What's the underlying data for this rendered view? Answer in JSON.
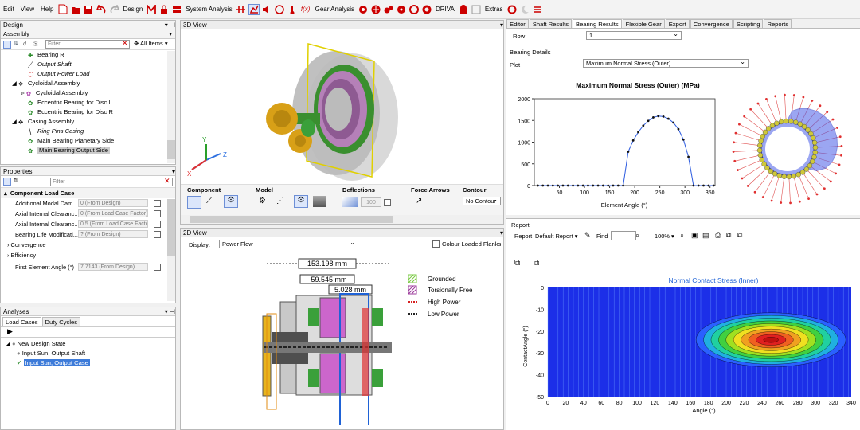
{
  "menu": {
    "edit": "Edit",
    "view": "View",
    "help": "Help",
    "design": "Design",
    "system_analysis": "System Analysis",
    "gear_analysis": "Gear Analysis",
    "driva": "DRIVA",
    "extras": "Extras"
  },
  "design_panel": {
    "title": "Design",
    "dropdown": "Assembly",
    "filter_placeholder": "Filter",
    "all_items": "All Items",
    "tree": [
      {
        "label": "Bearing R",
        "italic": false
      },
      {
        "label": "Output Shaft",
        "italic": true
      },
      {
        "label": "Output Power Load",
        "italic": true
      },
      {
        "label": "Cycloidal Assembly",
        "italic": false
      },
      {
        "label": "Cycloidal Assembly",
        "italic": false
      },
      {
        "label": "Eccentric Bearing for Disc L",
        "italic": false
      },
      {
        "label": "Eccentric Bearing for Disc R",
        "italic": false
      },
      {
        "label": "Casing Assembly",
        "italic": false
      },
      {
        "label": "Ring Pins Casing",
        "italic": true
      },
      {
        "label": "Main Bearing Planetary Side",
        "italic": false
      },
      {
        "label": "Main Bearing Output Side",
        "italic": false
      }
    ]
  },
  "properties": {
    "title": "Properties",
    "filter_placeholder": "Filter",
    "section": "Component Load Case",
    "rows": [
      {
        "label": "Additional Modal Dam...",
        "value": "0 (From Design)"
      },
      {
        "label": "Axial Internal Clearanc...",
        "value": "0 (From Load Case Factor)"
      },
      {
        "label": "Axial Internal Clearanc...",
        "value": "0.5 (From Load Case Factor)"
      },
      {
        "label": "Bearing Life Modificati...",
        "value": "? (From Design)"
      }
    ],
    "groups": [
      "Convergence",
      "Efficiency"
    ],
    "last_row": {
      "label": "First Element Angle (°)",
      "value": "7.7143 (From Design)"
    }
  },
  "analyses": {
    "title": "Analyses",
    "tabs": [
      "Load Cases",
      "Duty Cycles"
    ],
    "root": "New Design State",
    "items": [
      "Input Sun, Output Shaft",
      "Input Sun, Output Case"
    ]
  },
  "view3d": {
    "title": "3D View",
    "groups": {
      "component": "Component",
      "model": "Model",
      "deflections": "Deflections",
      "force_arrows": "Force Arrows",
      "contour": "Contour"
    },
    "deflection_value": "100",
    "contour_value": "No Contour",
    "axes": {
      "x": "X",
      "y": "Y",
      "z": "Z"
    }
  },
  "view2d": {
    "title": "2D View",
    "display_label": "Display:",
    "display_value": "Power Flow",
    "colour_flanks": "Colour Loaded Flanks",
    "dims": [
      "153.198 mm",
      "59.545 mm",
      "5.028 mm"
    ],
    "legend": [
      {
        "label": "Grounded",
        "color": "#7ac943"
      },
      {
        "label": "Torsionally Free",
        "color": "#9b3a9b"
      },
      {
        "label": "High Power",
        "color": "#d62020"
      },
      {
        "label": "Low Power",
        "color": "#222222"
      }
    ]
  },
  "right_tabs": [
    "Editor",
    "Shaft Results",
    "Bearing Results",
    "Flexible Gear",
    "Export",
    "Convergence",
    "Scripting",
    "Reports"
  ],
  "bearing": {
    "row_label": "Row",
    "row_value": "1",
    "details": "Bearing Details",
    "plot_label": "Plot",
    "plot_value": "Maximum Normal Stress (Outer)"
  },
  "chart_data": [
    {
      "type": "line",
      "title": "Maximum Normal Stress (Outer) (MPa)",
      "xlabel": "Element Angle (°)",
      "ylabel": "",
      "xlim": [
        0,
        360
      ],
      "ylim": [
        0,
        2000
      ],
      "xticks": [
        50,
        100,
        150,
        200,
        250,
        300,
        350
      ],
      "yticks": [
        0,
        500,
        1000,
        1500,
        2000
      ],
      "x": [
        7,
        17,
        27,
        37,
        47,
        57,
        67,
        77,
        87,
        97,
        107,
        117,
        127,
        137,
        147,
        157,
        167,
        177,
        187,
        197,
        207,
        217,
        227,
        237,
        247,
        257,
        267,
        277,
        287,
        297,
        307,
        317,
        327,
        337,
        347,
        357
      ],
      "y": [
        0,
        0,
        0,
        0,
        0,
        0,
        0,
        0,
        0,
        0,
        0,
        0,
        0,
        0,
        0,
        0,
        0,
        0,
        780,
        1040,
        1230,
        1380,
        1490,
        1570,
        1600,
        1590,
        1540,
        1450,
        1300,
        1060,
        660,
        0,
        0,
        0,
        0,
        0
      ]
    },
    {
      "type": "heatmap",
      "title": "Normal Contact Stress (Inner)",
      "xlabel": "Angle (°)",
      "ylabel": "ContactAngle (°)",
      "xlim": [
        0,
        340
      ],
      "ylim": [
        -50,
        0
      ],
      "xticks": [
        0,
        20,
        40,
        60,
        80,
        100,
        120,
        140,
        160,
        180,
        200,
        220,
        240,
        260,
        280,
        300,
        320,
        340
      ],
      "yticks": [
        0,
        -10,
        -20,
        -30,
        -40,
        -50
      ],
      "peak": {
        "x": 250,
        "y": -24
      }
    }
  ],
  "report": {
    "title": "Report",
    "label": "Report",
    "default": "Default Report",
    "find": "Find",
    "zoom": "100%"
  }
}
